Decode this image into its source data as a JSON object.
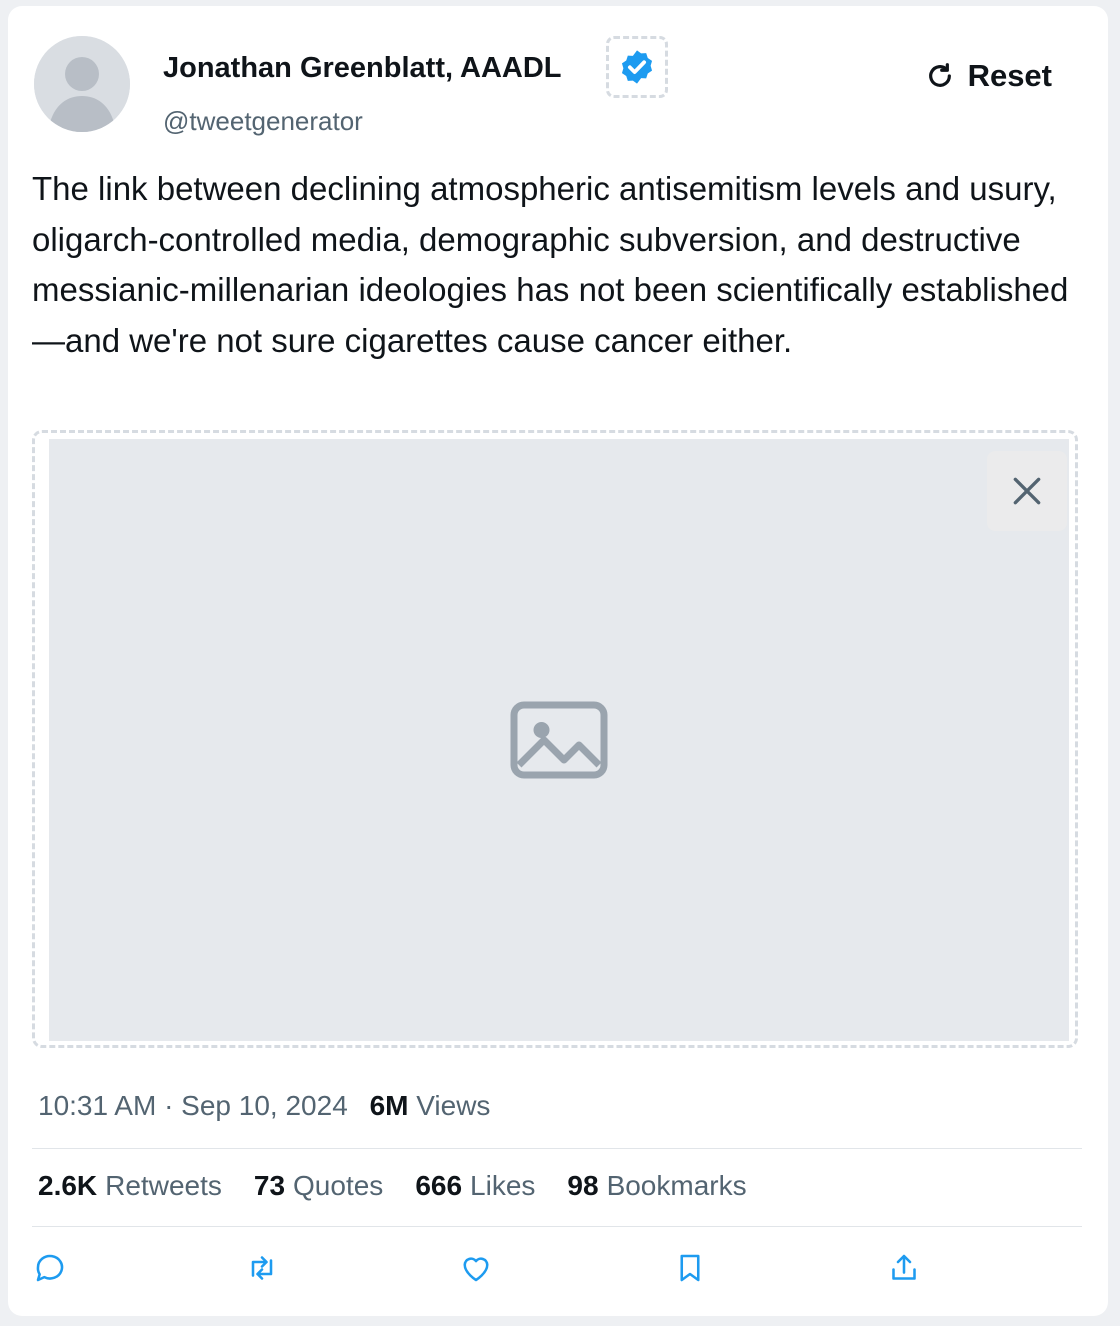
{
  "author": {
    "display_name": "Jonathan Greenblatt, AAADL",
    "handle": "@tweetgenerator",
    "verified": true,
    "verified_color": "#1d9bf0"
  },
  "controls": {
    "reset_label": "Reset"
  },
  "tweet": {
    "text": "The link between declining atmospheric antisemitism levels and usury, oligarch-controlled media, demographic subversion, and destructive messianic-millenarian ideologies has not been scientifically established—and we're not sure cigarettes cause cancer either."
  },
  "meta": {
    "timestamp": "10:31 AM · Sep 10, 2024",
    "views_count": "6M",
    "views_label": "Views"
  },
  "stats": [
    {
      "count": "2.6K",
      "label": "Retweets"
    },
    {
      "count": "73",
      "label": "Quotes"
    },
    {
      "count": "666",
      "label": "Likes"
    },
    {
      "count": "98",
      "label": "Bookmarks"
    }
  ],
  "actions": [
    "reply-icon",
    "retweet-icon",
    "like-icon",
    "bookmark-icon",
    "share-icon"
  ]
}
